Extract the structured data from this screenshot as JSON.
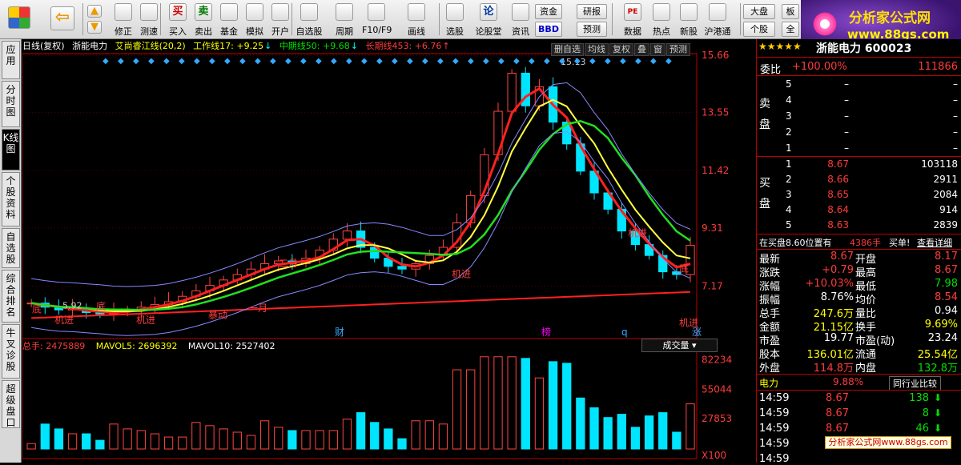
{
  "toolbar": {
    "buttons": [
      {
        "name": "修正",
        "icon": "refresh-icon"
      },
      {
        "name": "测速",
        "icon": "clock-icon"
      },
      {
        "name": "买入",
        "icon": "buy-icon",
        "glyph": "买"
      },
      {
        "name": "卖出",
        "icon": "sell-icon",
        "glyph": "卖"
      },
      {
        "name": "基金",
        "icon": "fund-icon"
      },
      {
        "name": "模拟",
        "icon": "hammer-icon"
      },
      {
        "name": "开户",
        "icon": "lock-icon"
      },
      {
        "name": "自选股",
        "icon": "folder-icon"
      },
      {
        "name": "周期",
        "icon": "cycle-icon"
      },
      {
        "name": "F10/F9",
        "icon": "doc-icon"
      },
      {
        "name": "画线",
        "icon": "pen-icon"
      },
      {
        "name": "选股",
        "icon": "screen-icon"
      },
      {
        "name": "论股堂",
        "icon": "forum-icon",
        "glyph": "论"
      },
      {
        "name": "资讯",
        "icon": "news-icon"
      },
      {
        "name": "数据",
        "icon": "pe-icon",
        "glyph": "PE"
      },
      {
        "name": "热点",
        "icon": "fire-icon"
      },
      {
        "name": "新股",
        "icon": "ipo-icon"
      },
      {
        "name": "沪港通",
        "icon": "hk-icon"
      }
    ],
    "small_buttons": [
      "资金",
      "BBD",
      "研报",
      "预测",
      "大盘",
      "个股",
      "板",
      "全"
    ]
  },
  "logo": {
    "title": "分析家公式网",
    "url": "www.88gs.com"
  },
  "left_tabs": [
    "应用",
    "分时图",
    "K线图",
    "个股资料",
    "自选股",
    "综合排名",
    "牛叉诊股",
    "超级盘口"
  ],
  "chart": {
    "title": {
      "period": "日线(复权)",
      "stock": "浙能电力",
      "indicator": "艾尚睿江线(20,2)",
      "work": "工作线17: +9.25",
      "mid": "中期线50: +9.68",
      "long": "长期线453: +6.76"
    },
    "controls": [
      "删自选",
      "均线",
      "复权",
      "叠",
      "窗",
      "预测"
    ],
    "price_axis": [
      "15.66",
      "13.55",
      "11.42",
      "9.31",
      "7.17"
    ],
    "high_label": "15.13",
    "low_label": "5.92",
    "annotations": [
      "底",
      "机进",
      "底",
      "机进",
      "暴动",
      "一月",
      "机进",
      "机进",
      "底",
      "二月",
      "机进"
    ],
    "event_labels": [
      "财",
      "榜",
      "q",
      "涨"
    ],
    "volume_title": {
      "total": "总手: 2475889",
      "ma5": "MAVOL5: 2696392",
      "ma10": "MAVOL10: 2527402"
    },
    "volume_select": "成交量",
    "volume_axis": [
      "82234",
      "55044",
      "27853",
      "X100"
    ]
  },
  "chart_data": {
    "type": "candlestick",
    "title": "浙能电力",
    "price_ticks": [
      15.66,
      13.55,
      11.42,
      9.31,
      7.17
    ],
    "volume_ticks": [
      82234,
      55044,
      27853
    ],
    "close": [
      6.55,
      6.4,
      6.3,
      6.35,
      6.2,
      6.15,
      6.25,
      6.3,
      6.4,
      6.5,
      6.6,
      6.8,
      7.0,
      7.2,
      7.4,
      7.6,
      7.8,
      8.0,
      8.1,
      8.0,
      8.2,
      8.5,
      8.9,
      9.2,
      8.6,
      8.2,
      7.9,
      7.8,
      8.0,
      8.3,
      8.6,
      9.5,
      10.5,
      12.0,
      13.6,
      15.0,
      13.8,
      14.5,
      13.2,
      12.4,
      11.4,
      10.6,
      10.0,
      9.2,
      8.7,
      8.3,
      7.7,
      7.6,
      8.67
    ]
  },
  "quote": {
    "header": "浙能电力 600023",
    "weibi_label": "委比",
    "weibi": "+100.00%",
    "weicha": "111866",
    "sell_label": "卖盘",
    "buy_label": "买盘",
    "asks": [
      {
        "lvl": "5",
        "price": "–",
        "vol": "–"
      },
      {
        "lvl": "4",
        "price": "–",
        "vol": "–"
      },
      {
        "lvl": "3",
        "price": "–",
        "vol": "–"
      },
      {
        "lvl": "2",
        "price": "–",
        "vol": "–"
      },
      {
        "lvl": "1",
        "price": "–",
        "vol": "–"
      }
    ],
    "bids": [
      {
        "lvl": "1",
        "price": "8.67",
        "vol": "103118"
      },
      {
        "lvl": "2",
        "price": "8.66",
        "vol": "2911"
      },
      {
        "lvl": "3",
        "price": "8.65",
        "vol": "2084"
      },
      {
        "lvl": "4",
        "price": "8.64",
        "vol": "914"
      },
      {
        "lvl": "5",
        "price": "8.63",
        "vol": "2839"
      }
    ],
    "bidline": {
      "text": "在买盘8.60位置有",
      "vol": "4386手",
      "buy": "买单!",
      "detail": "查看详细"
    },
    "stats": [
      [
        "最新",
        "8.67",
        "开盘",
        "8.17"
      ],
      [
        "涨跌",
        "+0.79",
        "最高",
        "8.67"
      ],
      [
        "涨幅",
        "+10.03%",
        "最低",
        "7.98"
      ],
      [
        "振幅",
        "8.76%",
        "均价",
        "8.54"
      ],
      [
        "总手",
        "247.6万",
        "量比",
        "0.94"
      ],
      [
        "金额",
        "21.15亿",
        "换手",
        "9.69%"
      ],
      [
        "市盈",
        "19.77",
        "市盈(动)",
        "23.24"
      ],
      [
        "股本",
        "136.01亿",
        "流通",
        "25.54亿"
      ],
      [
        "外盘",
        "114.8万",
        "内盘",
        "132.8万"
      ]
    ],
    "industry": {
      "name": "电力",
      "pct": "9.88%",
      "compare": "同行业比较"
    },
    "ticks": [
      {
        "time": "14:59",
        "price": "8.67",
        "vol": "138"
      },
      {
        "time": "14:59",
        "price": "8.67",
        "vol": "8"
      },
      {
        "time": "14:59",
        "price": "8.67",
        "vol": "46"
      },
      {
        "time": "14:59",
        "price": "",
        "vol": ""
      },
      {
        "time": "14:59",
        "price": "",
        "vol": ""
      }
    ]
  },
  "watermark": "分析家公式网www.88gs.com"
}
